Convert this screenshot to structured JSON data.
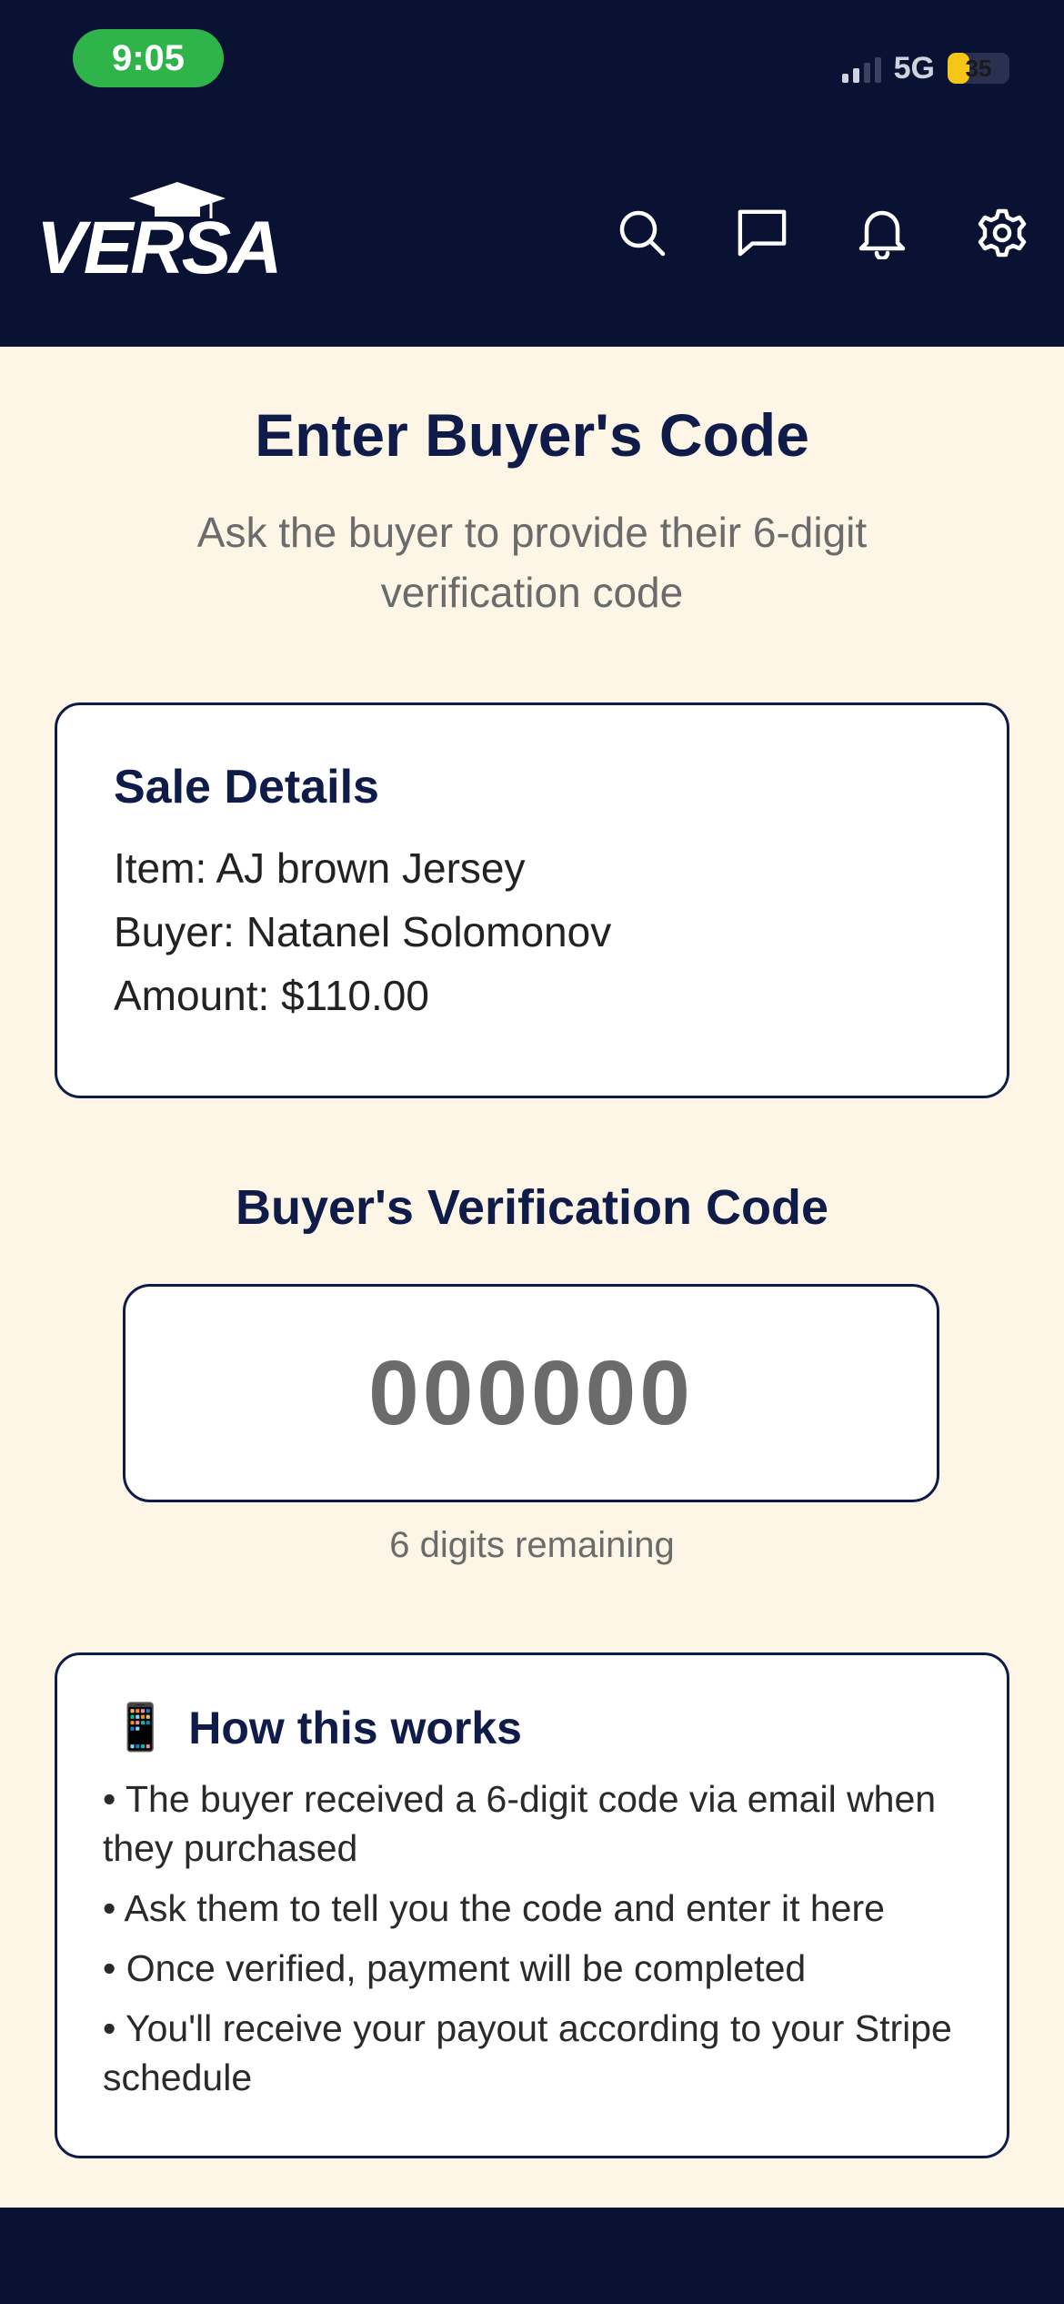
{
  "status": {
    "time": "9:05",
    "network": "5G",
    "battery": "35",
    "battery_level": 0.35
  },
  "header": {
    "logo_text": "VERSA",
    "icons": [
      "search-icon",
      "chat-icon",
      "bell-icon",
      "settings-icon"
    ]
  },
  "page": {
    "title": "Enter Buyer's Code",
    "subtitle": "Ask the buyer to provide their 6-digit verification code"
  },
  "sale": {
    "title": "Sale Details",
    "item": "Item: AJ brown Jersey",
    "buyer": "Buyer: Natanel Solomonov",
    "amount": "Amount: $110.00"
  },
  "verification": {
    "label": "Buyer's Verification Code",
    "placeholder": "000000",
    "hint": "6 digits remaining"
  },
  "how": {
    "emoji": "📱",
    "title": "How this works",
    "items": [
      "• The buyer received a 6-digit code via email when they purchased",
      "• Ask them to tell you the code and enter it here",
      "• Once verified, payment will be completed",
      "• You'll receive your payout according to your Stripe schedule"
    ]
  },
  "colors": {
    "navy": "#0a1233",
    "background": "#fdf6e6",
    "accent_text": "#0f1c4a",
    "status_green": "#2fb44a"
  }
}
